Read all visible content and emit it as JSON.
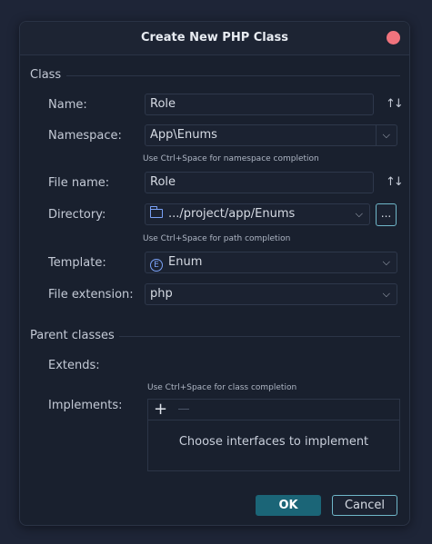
{
  "dialog": {
    "title": "Create New PHP Class"
  },
  "sections": {
    "class": "Class",
    "parent": "Parent classes"
  },
  "fields": {
    "name": {
      "label": "Name:",
      "value": "Role"
    },
    "namespace": {
      "label": "Namespace:",
      "value": "App\\Enums",
      "hint": "Use Ctrl+Space for namespace completion"
    },
    "file_name": {
      "label": "File name:",
      "value": "Role"
    },
    "directory": {
      "label": "Directory:",
      "value": ".../project/app/Enums",
      "hint": "Use Ctrl+Space for path completion",
      "browse": "..."
    },
    "template": {
      "label": "Template:",
      "value": "Enum",
      "badge": "E"
    },
    "extension": {
      "label": "File extension:",
      "value": "php"
    },
    "extends": {
      "label": "Extends:"
    },
    "implements": {
      "label": "Implements:",
      "hint": "Use Ctrl+Space for class completion",
      "empty": "Choose interfaces to implement",
      "add": "+"
    }
  },
  "buttons": {
    "ok": "OK",
    "cancel": "Cancel"
  },
  "icons": {
    "swap": "↑↓",
    "chevron": "⌵"
  },
  "colors": {
    "accent": "#1b6577",
    "close": "#f0737d",
    "focus_border": "#6fb7c9"
  }
}
